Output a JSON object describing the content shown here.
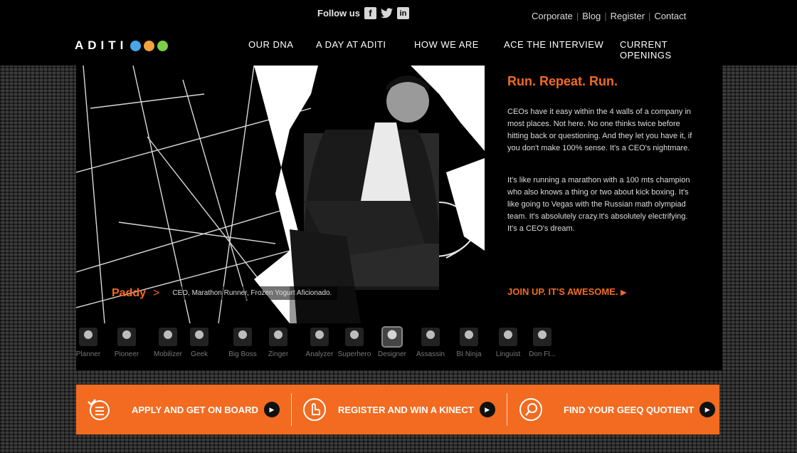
{
  "header": {
    "follow_label": "Follow us",
    "social": {
      "facebook_letter": "f",
      "twitter_glyph": "🐦",
      "linkedin_letters": "in"
    },
    "links": [
      "Corporate",
      "Blog",
      "Register",
      "Contact"
    ],
    "logo_text": "ADITI",
    "logo_dots": [
      "#49a7e8",
      "#f4a23a",
      "#7ccf47"
    ],
    "nav": [
      "OUR DNA",
      "A DAY AT ADITI",
      "HOW WE ARE",
      "ACE THE INTERVIEW",
      "CURRENT OPENINGS"
    ]
  },
  "profile": {
    "name": "Paddy",
    "arrow": ">",
    "caption": "CEO, Marathon Runner, Frozen Yogurt Aficionado.",
    "title": "Run. Repeat. Run.",
    "paragraph_1": "CEOs have it easy within the 4 walls of a company in most places. Not here. No one thinks twice before hitting back or questioning. And they let you have it, if you don't make 100% sense. It's a CEO's nightmare.",
    "paragraph_2": "It's like running a marathon with a 100 mts champion who also knows a thing or two about kick boxing. It's like going to Vegas with the Russian math olympiad team. It's absolutely crazy.It's absolutely electrifying. It's a CEO's dream.",
    "cta": "JOIN UP. IT'S AWESOME.",
    "cta_arrow": "▶"
  },
  "team": [
    "Planner",
    "Pioneer",
    "Mobilizer",
    "Geek",
    "Big Boss",
    "Zinger",
    "Analyzer",
    "Superhero",
    "Designer",
    "Assassin",
    "BI Ninja",
    "Linguist",
    "Don Fl..."
  ],
  "actions": {
    "apply": "APPLY AND GET ON BOARD",
    "register": "REGISTER AND WIN A KINECT",
    "geeq": "FIND YOUR GEEQ QUOTIENT",
    "play_glyph": "▶"
  },
  "colors": {
    "accent": "#f26b21",
    "bar": "#f26b21",
    "panel": "#000000"
  }
}
